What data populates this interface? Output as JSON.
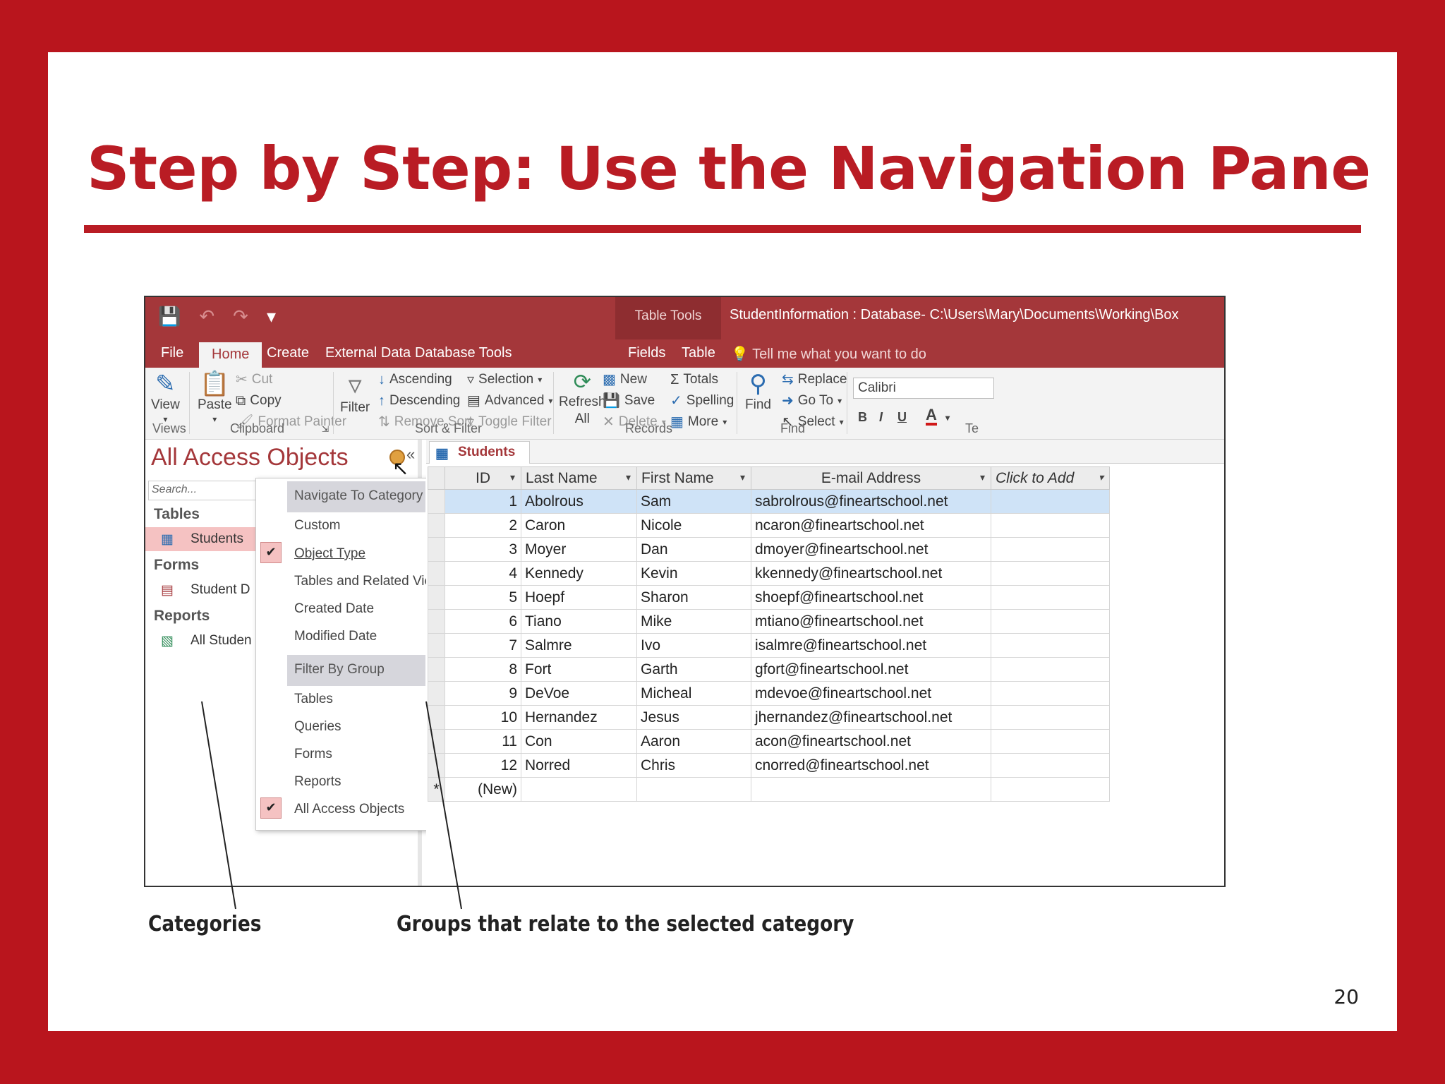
{
  "slide": {
    "title": "Step by Step: Use the Navigation Pane",
    "page_number": "20",
    "callouts": {
      "categories": "Categories",
      "groups": "Groups that relate to the selected category"
    }
  },
  "window": {
    "title": "StudentInformation : Database- C:\\Users\\Mary\\Documents\\Working\\Box",
    "contextual_label": "Table Tools",
    "tabs": [
      "File",
      "Home",
      "Create",
      "External Data",
      "Database Tools",
      "Fields",
      "Table"
    ],
    "active_tab": "Home",
    "tell_me": "Tell me what you want to do"
  },
  "ribbon": {
    "views": {
      "view": "View",
      "group": "Views"
    },
    "clipboard": {
      "paste": "Paste",
      "cut": "Cut",
      "copy": "Copy",
      "format_painter": "Format Painter",
      "group": "Clipboard"
    },
    "sort_filter": {
      "filter": "Filter",
      "ascending": "Ascending",
      "descending": "Descending",
      "remove_sort": "Remove Sort",
      "selection": "Selection",
      "advanced": "Advanced",
      "toggle_filter": "Toggle Filter",
      "group": "Sort & Filter"
    },
    "records": {
      "refresh_1": "Refresh",
      "refresh_2": "All",
      "new": "New",
      "save": "Save",
      "delete": "Delete",
      "totals": "Totals",
      "spelling": "Spelling",
      "more": "More",
      "group": "Records"
    },
    "find": {
      "find": "Find",
      "replace": "Replace",
      "goto": "Go To",
      "select": "Select",
      "group": "Find"
    },
    "text": {
      "font": "Calibri",
      "bold": "B",
      "italic": "I",
      "underline": "U",
      "font_color": "A",
      "group": "Te"
    }
  },
  "nav_pane": {
    "title": "All Access Objects",
    "search_placeholder": "Search...",
    "headers": {
      "tables": "Tables",
      "forms": "Forms",
      "reports": "Reports"
    },
    "items": {
      "students": "Students",
      "student_form": "Student D",
      "report": "All Studen"
    },
    "menu": {
      "navigate_header": "Navigate To Category",
      "categories": [
        "Custom",
        "Object Type",
        "Tables and Related Views",
        "Created Date",
        "Modified Date"
      ],
      "filter_header": "Filter By Group",
      "groups": [
        "Tables",
        "Queries",
        "Forms",
        "Reports",
        "All Access Objects"
      ]
    }
  },
  "datasheet": {
    "tab": "Students",
    "columns": [
      "ID",
      "Last Name",
      "First Name",
      "E-mail Address",
      "Click to Add"
    ],
    "rows": [
      [
        "1",
        "Abolrous",
        "Sam",
        "sabrolrous@fineartschool.net"
      ],
      [
        "2",
        "Caron",
        "Nicole",
        "ncaron@fineartschool.net"
      ],
      [
        "3",
        "Moyer",
        "Dan",
        "dmoyer@fineartschool.net"
      ],
      [
        "4",
        "Kennedy",
        "Kevin",
        "kkennedy@fineartschool.net"
      ],
      [
        "5",
        "Hoepf",
        "Sharon",
        "shoepf@fineartschool.net"
      ],
      [
        "6",
        "Tiano",
        "Mike",
        "mtiano@fineartschool.net"
      ],
      [
        "7",
        "Salmre",
        "Ivo",
        "isalmre@fineartschool.net"
      ],
      [
        "8",
        "Fort",
        "Garth",
        "gfort@fineartschool.net"
      ],
      [
        "9",
        "DeVoe",
        "Micheal",
        "mdevoe@fineartschool.net"
      ],
      [
        "10",
        "Hernandez",
        "Jesus",
        "jhernandez@fineartschool.net"
      ],
      [
        "11",
        "Con",
        "Aaron",
        "acon@fineartschool.net"
      ],
      [
        "12",
        "Norred",
        "Chris",
        "cnorred@fineartschool.net"
      ]
    ],
    "new_row_marker": "*",
    "new_row_label": "(New)"
  },
  "colors": {
    "slide_red": "#b9151d",
    "access_red": "#a4373a",
    "selection_pink": "#f5c2c2",
    "row_highlight": "#cfe3f7"
  }
}
